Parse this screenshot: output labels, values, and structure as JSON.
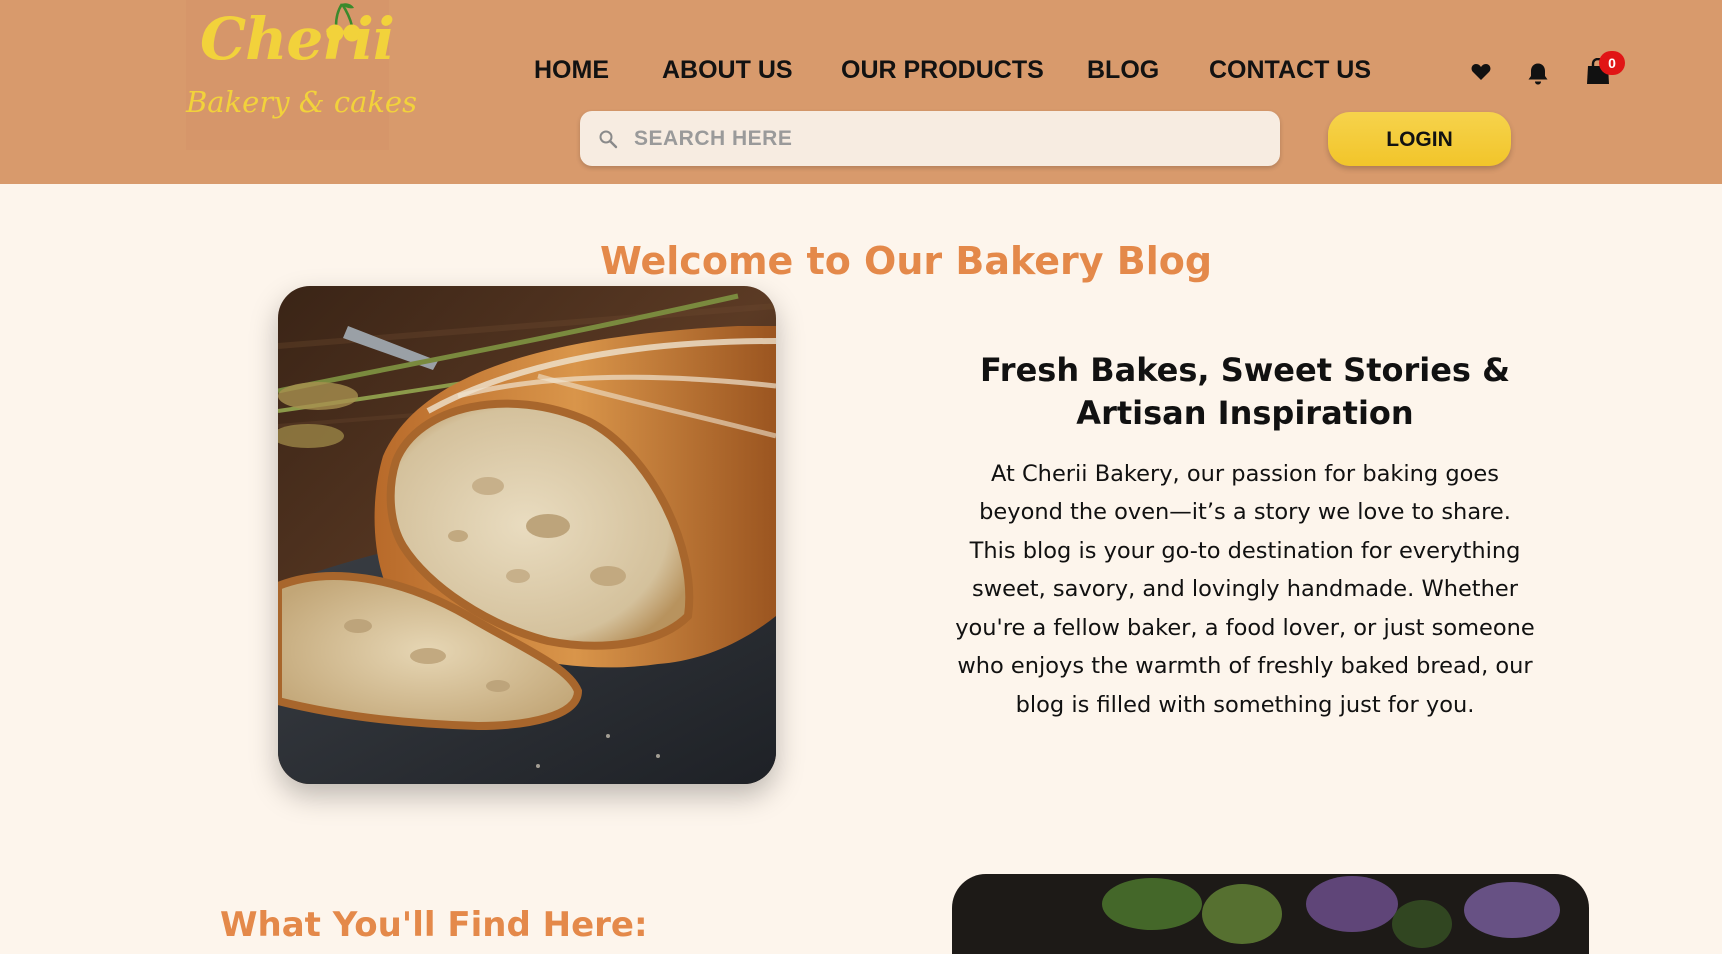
{
  "brand": {
    "name": "Cherii",
    "tagline": "Bakery & cakes",
    "logo_color": "#f2d23b"
  },
  "nav": {
    "items": [
      {
        "label": "HOME"
      },
      {
        "label": "ABOUT US"
      },
      {
        "label": "OUR PRODUCTS"
      },
      {
        "label": "BLOG"
      },
      {
        "label": "CONTACT US"
      }
    ]
  },
  "header_icons": {
    "wishlist": "heart-icon",
    "notifications": "bell-icon",
    "cart": "shopping-bag-icon",
    "cart_count": "0"
  },
  "search": {
    "placeholder": "SEARCH HERE",
    "value": ""
  },
  "auth": {
    "login_label": "LOGIN"
  },
  "main": {
    "title": "Welcome to Our Bakery Blog",
    "intro_heading": "Fresh Bakes, Sweet Stories & Artisan Inspiration",
    "intro_body": "At Cherii Bakery, our passion for baking goes beyond the oven—it’s a story we love to share. This blog is your go-to destination for everything sweet, savory, and lovingly handmade. Whether you're a fellow baker, a food lover, or just someone who enjoys the warmth of freshly baked bread, our blog is filled with something just for you.",
    "section_heading": "What You'll Find Here:"
  },
  "colors": {
    "header_bg": "#d89a6c",
    "page_bg": "#fdf5ec",
    "accent": "#e4894a",
    "button": "#f4cb38",
    "badge": "#e11515"
  }
}
